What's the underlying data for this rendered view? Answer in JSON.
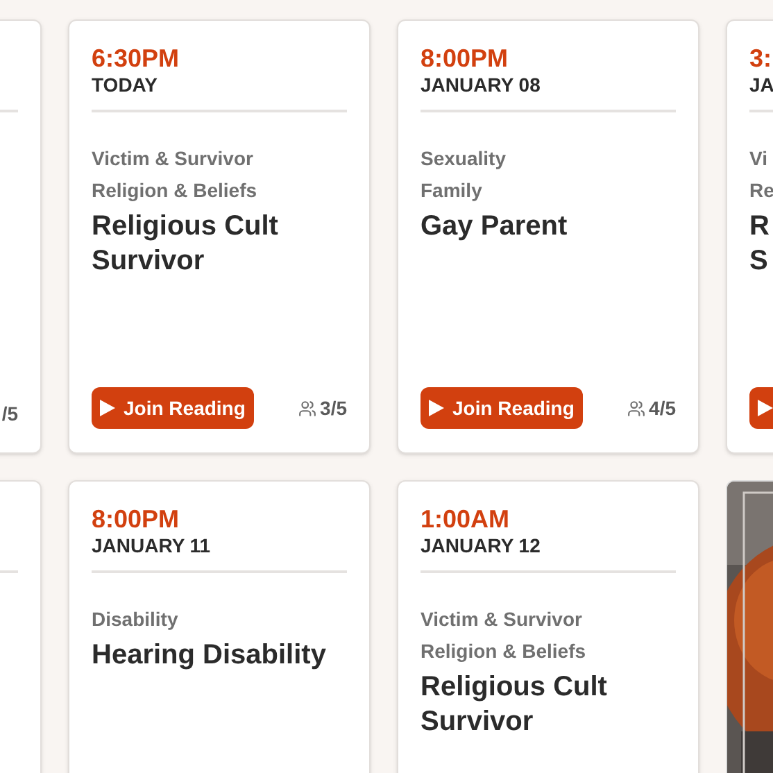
{
  "rows": [
    {
      "cards": [
        {
          "kind": "session",
          "participants": "/5"
        },
        {
          "kind": "session",
          "time": "6:30PM",
          "date": "TODAY",
          "categories": [
            "Victim & Survivor",
            "Religion & Beliefs"
          ],
          "title": "Religious Cult Survivor",
          "button": "Join Reading",
          "participants": "3/5"
        },
        {
          "kind": "session",
          "time": "8:00PM",
          "date": "JANUARY 08",
          "categories": [
            "Sexuality",
            "Family"
          ],
          "title": "Gay Parent",
          "button": "Join Reading",
          "participants": "4/5"
        },
        {
          "kind": "session",
          "time": "3:",
          "date": "JA",
          "categories": [
            "Vi",
            "Re"
          ],
          "title": "R S",
          "join_button": true
        }
      ]
    },
    {
      "cards": [
        {
          "kind": "session"
        },
        {
          "kind": "session",
          "time": "8:00PM",
          "date": "JANUARY 11",
          "categories": [
            "Disability"
          ],
          "title": "Hearing Disability"
        },
        {
          "kind": "session",
          "time": "1:00AM",
          "date": "JANUARY 12",
          "categories": [
            "Victim & Survivor",
            "Religion & Beliefs"
          ],
          "title": "Religious Cult Survivor"
        },
        {
          "kind": "picture"
        }
      ]
    }
  ]
}
